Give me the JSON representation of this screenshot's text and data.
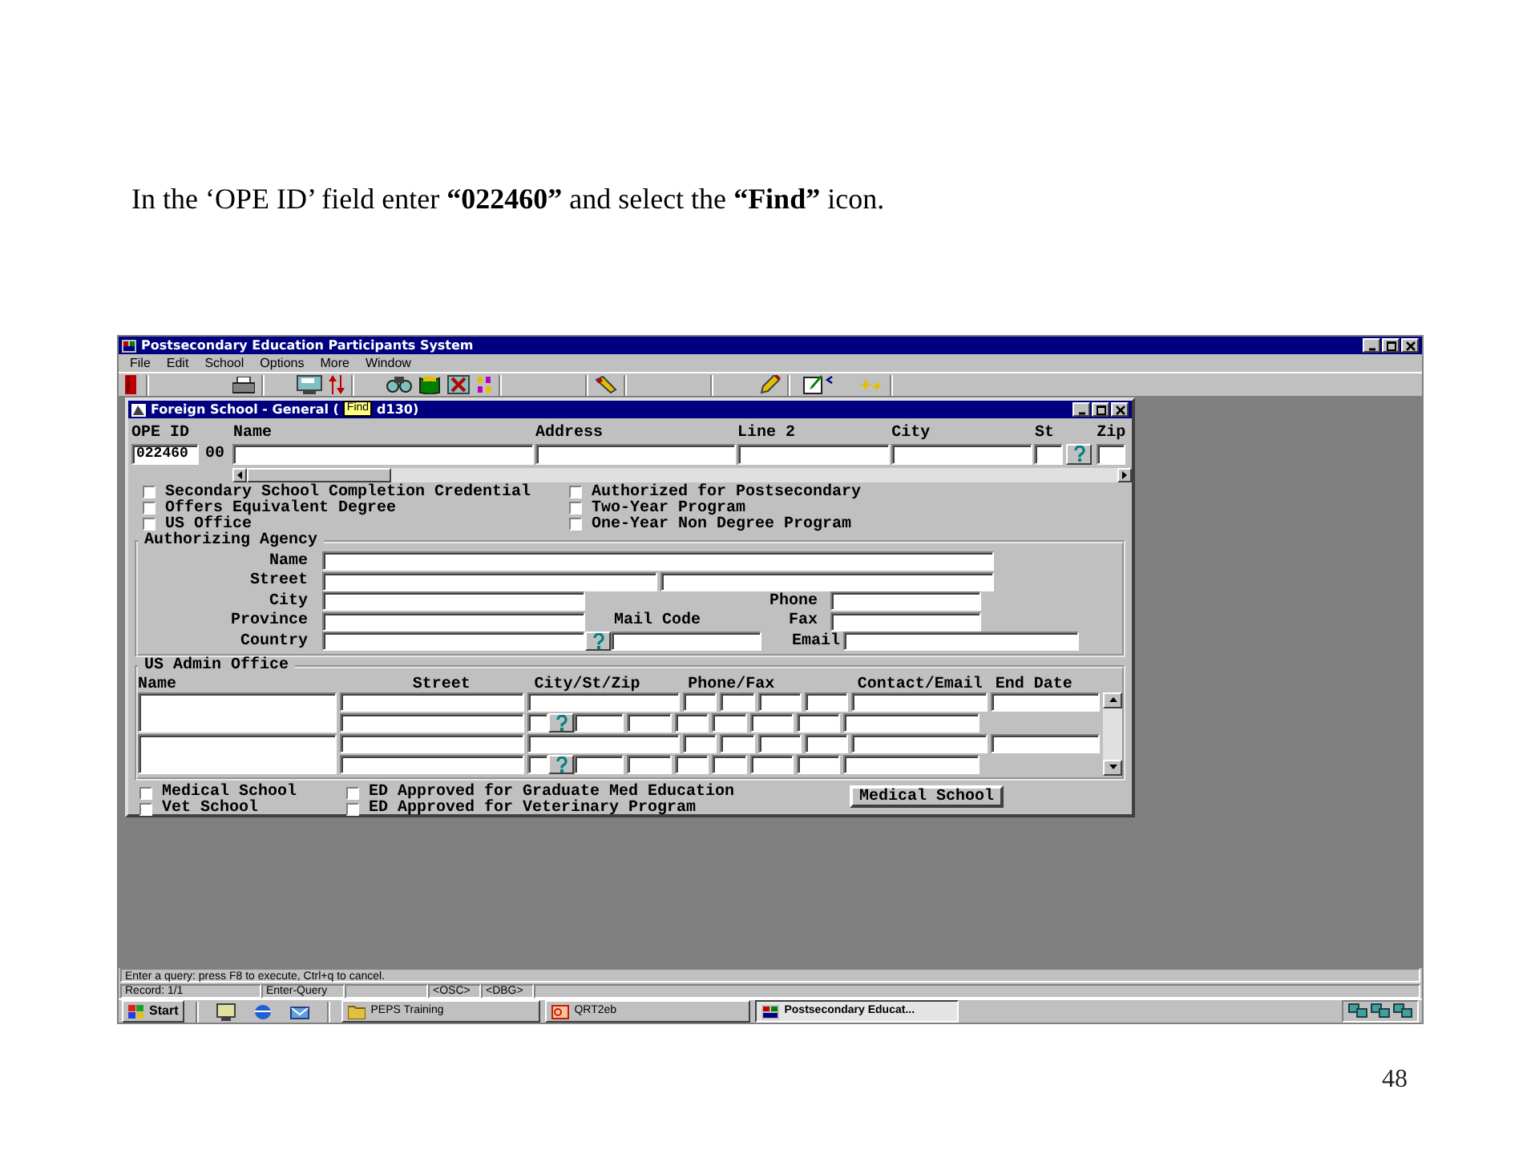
{
  "slide": {
    "instruction": "In the ‘OPE ID’ field enter **“022460”** and select the **“Find”** icon.",
    "page_number": "48"
  },
  "app_window": {
    "title": "Postsecondary Education Participants System",
    "menu": [
      "File",
      "Edit",
      "School",
      "Options",
      "More",
      "Window"
    ],
    "tooltip": "Find"
  },
  "form_window": {
    "title": "Foreign School - General (",
    "title_tail": "d130)",
    "ope_id": {
      "label": "OPE ID",
      "value": "022460",
      "suffix": "00"
    },
    "columns": [
      "Name",
      "Address",
      "Line 2",
      "City",
      "St",
      "Zip"
    ],
    "flags": [
      {
        "label": "Secondary School Completion Credential",
        "checked": false
      },
      {
        "label": "Offers Equivalent Degree",
        "checked": false
      },
      {
        "label": "US Office",
        "checked": false
      },
      {
        "label": "Authorized for Postsecondary",
        "checked": false
      },
      {
        "label": "Two-Year Program",
        "checked": false
      },
      {
        "label": "One-Year Non Degree Program",
        "checked": false
      }
    ],
    "authorizing_agency": {
      "legend": "Authorizing Agency",
      "labels": {
        "name": "Name",
        "street": "Street",
        "city": "City",
        "province": "Province",
        "country": "Country",
        "mail_code": "Mail Code",
        "phone": "Phone",
        "fax": "Fax",
        "email": "Email"
      }
    },
    "us_admin_office": {
      "legend": "US Admin Office",
      "columns": [
        "Name",
        "Street",
        "City/St/Zip",
        "Phone/Fax",
        "Contact/Email",
        "End Date"
      ]
    },
    "bottom_flags": [
      {
        "label": "Medical School",
        "checked": false
      },
      {
        "label": "Vet School",
        "checked": false
      },
      {
        "label": "ED Approved for Graduate Med Education",
        "checked": false
      },
      {
        "label": "ED Approved for Veterinary Program",
        "checked": false
      }
    ],
    "button": "Medical School"
  },
  "status_bar": {
    "message": "Enter a query:  press F8 to execute, Ctrl+q  to cancel.",
    "record": "Record: 1/1",
    "mode": "Enter-Query",
    "flags": [
      "<OSC>",
      "<DBG>"
    ]
  },
  "taskbar": {
    "start": "Start",
    "tasks": [
      {
        "label": "PEPS Training",
        "selected": false
      },
      {
        "label": "QRT2eb",
        "selected": false
      },
      {
        "label": "Postsecondary Educat...",
        "selected": true
      }
    ]
  }
}
